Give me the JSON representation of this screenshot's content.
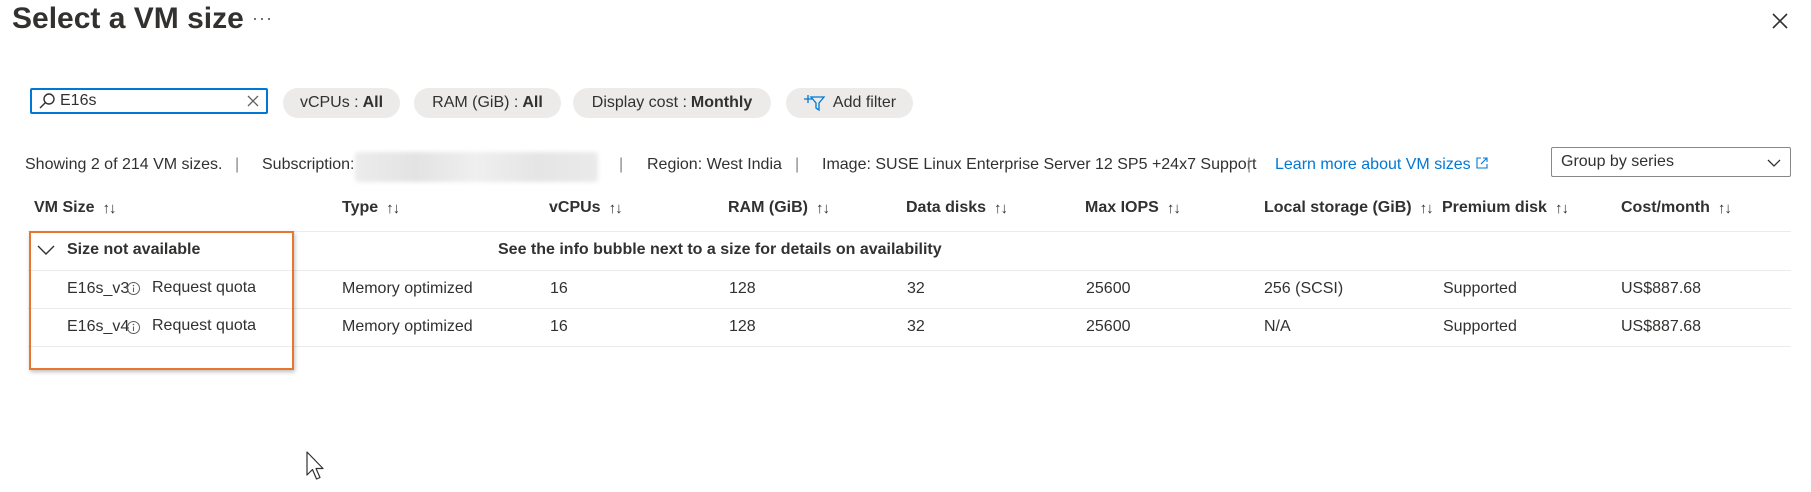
{
  "header": {
    "title": "Select a VM size",
    "more": "···"
  },
  "search": {
    "value": "E16s",
    "placeholder": ""
  },
  "filters": {
    "vcpus": {
      "label": "vCPUs :",
      "value": "All"
    },
    "ram": {
      "label": "RAM (GiB) :",
      "value": "All"
    },
    "cost": {
      "label": "Display cost :",
      "value": "Monthly"
    },
    "add_filter": "Add filter"
  },
  "info": {
    "showing": "Showing 2 of 214 VM sizes.",
    "sep": "|",
    "subscription_label": "Subscription:",
    "region": "Region: West India",
    "image": "Image: SUSE Linux Enterprise Server 12 SP5 +24x7 Support",
    "learn_more": "Learn more about VM sizes"
  },
  "group_by": {
    "selected": "Group by series"
  },
  "columns": [
    "VM Size",
    "Type",
    "vCPUs",
    "RAM (GiB)",
    "Data disks",
    "Max IOPS",
    "Local storage (GiB)",
    "Premium disk",
    "Cost/month"
  ],
  "sort_glyph": "↑↓",
  "group": {
    "title": "Size not available",
    "info": "See the info bubble next to a size for details on availability"
  },
  "rows": [
    {
      "name": "E16s_v3",
      "action": "Request quota",
      "type": "Memory optimized",
      "vcpus": "16",
      "ram": "128",
      "data_disks": "32",
      "max_iops": "25600",
      "local_storage": "256 (SCSI)",
      "premium_disk": "Supported",
      "cost": "US$887.68"
    },
    {
      "name": "E16s_v4",
      "action": "Request quota",
      "type": "Memory optimized",
      "vcpus": "16",
      "ram": "128",
      "data_disks": "32",
      "max_iops": "25600",
      "local_storage": "N/A",
      "premium_disk": "Supported",
      "cost": "US$887.68"
    }
  ],
  "colors": {
    "accent": "#0078d4",
    "highlight": "#e8762d",
    "pill_bg": "#edebe9"
  }
}
